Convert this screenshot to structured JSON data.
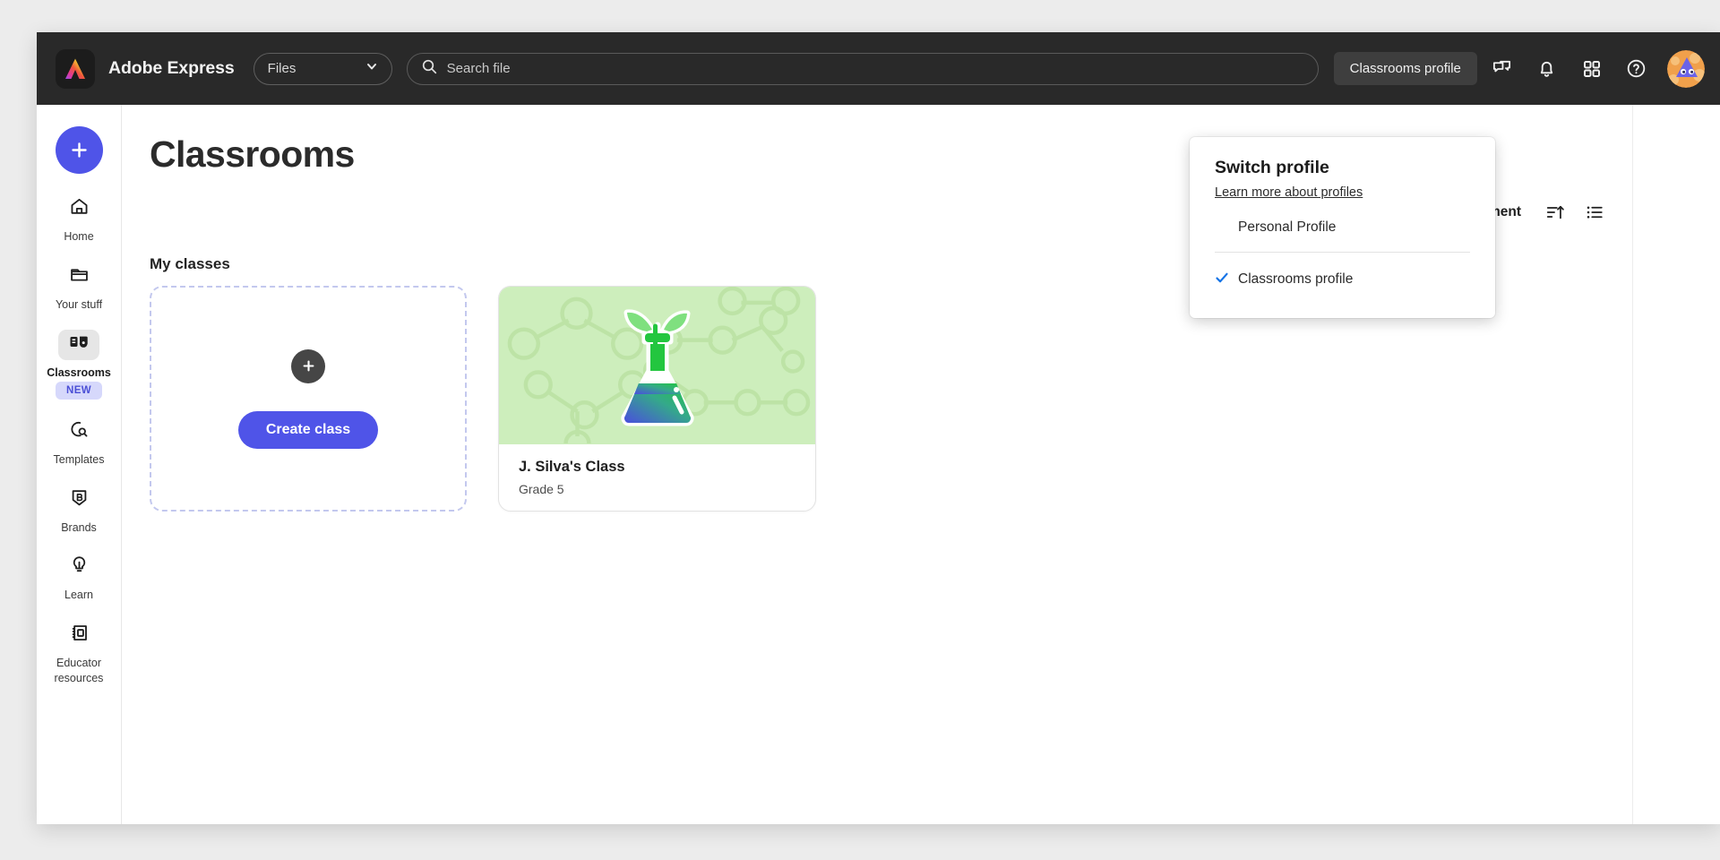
{
  "topbar": {
    "app_title": "Adobe Express",
    "files_dropdown": {
      "label": "Files",
      "icon": "chevron-down-icon"
    },
    "search": {
      "placeholder": "Search file",
      "value": "",
      "icon": "search-icon"
    },
    "profile_pill": "Classrooms profile",
    "icons": [
      "comments-icon",
      "bell-icon",
      "apps-grid-icon",
      "help-icon"
    ],
    "avatar": "user-avatar"
  },
  "sidebar": {
    "create_button": "create-new-button",
    "items": [
      {
        "label": "Home",
        "icon": "home-icon",
        "active": false
      },
      {
        "label": "Your stuff",
        "icon": "folder-icon",
        "active": false
      },
      {
        "label": "Classrooms",
        "icon": "classrooms-icon",
        "active": true,
        "badge": "NEW"
      },
      {
        "label": "Templates",
        "icon": "templates-search-icon",
        "active": false
      },
      {
        "label": "Brands",
        "icon": "brand-shield-icon",
        "active": false
      },
      {
        "label": "Learn",
        "icon": "lightbulb-icon",
        "active": false
      },
      {
        "label": "Educator resources",
        "icon": "notebook-icon",
        "active": false
      }
    ]
  },
  "main": {
    "page_title": "Classrooms",
    "section_title": "My classes",
    "toolbar": {
      "create_assignment": "Create assignment",
      "sort_icon": "sort-ascending-icon",
      "view_icon": "list-view-icon"
    },
    "create_class_card": {
      "plus_icon": "plus-icon",
      "button_label": "Create class"
    },
    "classes": [
      {
        "name": "J. Silva's Class",
        "grade": "Grade 5",
        "thumbnail": "science-flask-illustration",
        "thumb_color": "#cdeebc"
      }
    ]
  },
  "switch_profile_popover": {
    "title": "Switch profile",
    "link": "Learn more about profiles",
    "options": [
      {
        "label": "Personal Profile",
        "selected": false
      },
      {
        "label": "Classrooms profile",
        "selected": true,
        "icon": "check-icon"
      }
    ]
  },
  "colors": {
    "accent_blue": "#4f54e8",
    "topbar_dark": "#292929",
    "badge_bg": "#d6d8fb",
    "badge_text": "#4b4fd6",
    "check_blue": "#1473e6",
    "card_green": "#cdeebc"
  }
}
